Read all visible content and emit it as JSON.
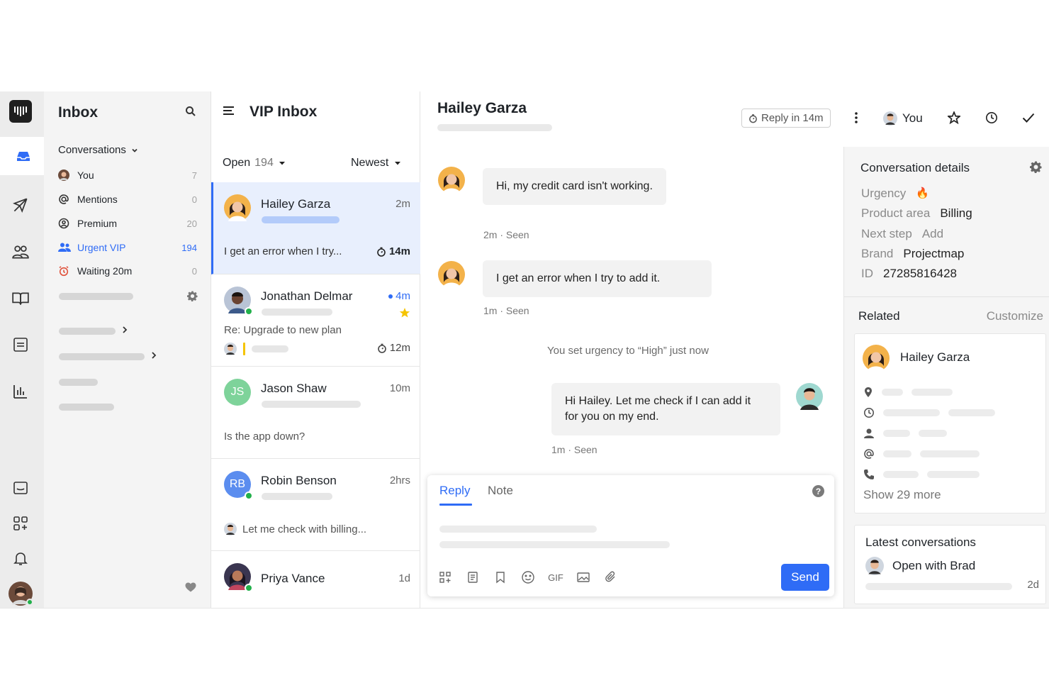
{
  "rail": {
    "icons": [
      "inbox-icon",
      "outbound-icon",
      "contacts-icon",
      "knowledge-icon",
      "reports-list-icon",
      "reports-chart-icon",
      "conversation-icon",
      "apps-icon",
      "notifications-icon"
    ]
  },
  "nav": {
    "title": "Inbox",
    "section_label": "Conversations",
    "items": [
      {
        "label": "You",
        "count": "7"
      },
      {
        "label": "Mentions",
        "count": "0"
      },
      {
        "label": "Premium",
        "count": "20"
      },
      {
        "label": "Urgent VIP",
        "count": "194"
      },
      {
        "label": "Waiting 20m",
        "count": "0"
      }
    ]
  },
  "list": {
    "title": "VIP Inbox",
    "filter": "Open",
    "filter_count": "194",
    "sort": "Newest",
    "conversations": [
      {
        "name": "Hailey Garza",
        "time": "2m",
        "preview": "I get an error when I try...",
        "timer": "14m"
      },
      {
        "name": "Jonathan Delmar",
        "time": "4m",
        "preview": "Re: Upgrade to new plan",
        "timer": "12m"
      },
      {
        "name": "Jason Shaw",
        "initials": "JS",
        "time": "10m",
        "preview": "Is the app down?"
      },
      {
        "name": "Robin Benson",
        "initials": "RB",
        "time": "2hrs",
        "preview": "Let me check with billing..."
      },
      {
        "name": "Priya Vance",
        "time": "1d"
      }
    ]
  },
  "thread": {
    "contact_name": "Hailey Garza",
    "messages": [
      {
        "text": "Hi, my credit card isn't working.",
        "meta": "2m · Seen"
      },
      {
        "text": "I get an error when I try to add it.",
        "meta": "1m · Seen"
      },
      {
        "text": "Hi Hailey. Let me check if I can add it for you on my end.",
        "meta": "1m · Seen"
      }
    ],
    "system_message": "You set urgency to “High” just now"
  },
  "composer": {
    "tab_reply": "Reply",
    "tab_note": "Note",
    "help": "?",
    "gif": "GIF",
    "send": "Send"
  },
  "topbar": {
    "reply_in": "Reply in 14m",
    "assignee": "You"
  },
  "details": {
    "title": "Conversation details",
    "attributes": [
      {
        "key": "Urgency",
        "value": "🔥"
      },
      {
        "key": "Product area",
        "value": "Billing"
      },
      {
        "key": "Next step",
        "value": "Add"
      },
      {
        "key": "Brand",
        "value": "Projectmap"
      },
      {
        "key": "ID",
        "value": "27285816428"
      }
    ],
    "related_label": "Related",
    "customize_label": "Customize",
    "related_contact": "Hailey Garza",
    "show_more": "Show 29 more",
    "latest_title": "Latest conversations",
    "latest_item": "Open with Brad",
    "latest_time": "2d"
  },
  "colors": {
    "accent": "#2f6cf6",
    "urgent": "#ff5a1f",
    "online": "#22b04b",
    "star": "#f5c400"
  }
}
